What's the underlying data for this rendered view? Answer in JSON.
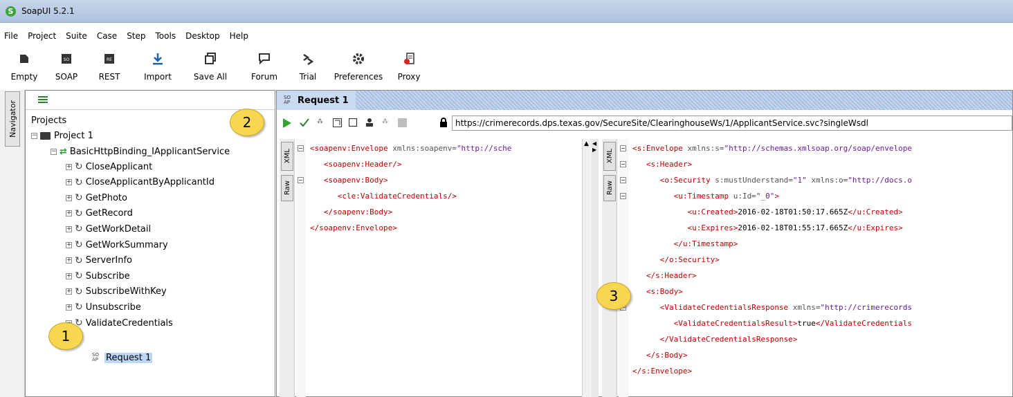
{
  "window": {
    "title": "SoapUI 5.2.1"
  },
  "menu": [
    "File",
    "Project",
    "Suite",
    "Case",
    "Step",
    "Tools",
    "Desktop",
    "Help"
  ],
  "toolbar": [
    {
      "label": "Empty",
      "icon": "empty-project-icon"
    },
    {
      "label": "SOAP",
      "icon": "soap-icon"
    },
    {
      "label": "REST",
      "icon": "rest-icon"
    },
    {
      "label": "Import",
      "icon": "import-icon"
    },
    {
      "label": "Save All",
      "icon": "save-all-icon"
    },
    {
      "label": "Forum",
      "icon": "forum-icon"
    },
    {
      "label": "Trial",
      "icon": "trial-icon"
    },
    {
      "label": "Preferences",
      "icon": "preferences-icon"
    },
    {
      "label": "Proxy",
      "icon": "proxy-icon"
    }
  ],
  "navigator": {
    "tab": "Navigator",
    "root": "Projects",
    "project": "Project 1",
    "binding": "BasicHttpBinding_IApplicantService",
    "operations": [
      "CloseApplicant",
      "CloseApplicantByApplicantId",
      "GetPhoto",
      "GetRecord",
      "GetWorkDetail",
      "GetWorkSummary",
      "ServerInfo",
      "Subscribe",
      "SubscribeWithKey",
      "Unsubscribe",
      "ValidateCredentials"
    ],
    "selected_request": "Request 1",
    "soap_badge": "SO AP"
  },
  "request": {
    "title": "Request 1",
    "url": "https://crimerecords.dps.texas.gov/SecureSite/ClearinghouseWs/1/ApplicantService.svc?singleWsdl",
    "tabs": [
      "XML",
      "Raw"
    ]
  },
  "request_xml": [
    "<soapenv:Envelope xmlns:soapenv=\"http://sche",
    "   <soapenv:Header/>",
    "   <soapenv:Body>",
    "      <cle:ValidateCredentials/>",
    "   </soapenv:Body>",
    "</soapenv:Envelope>"
  ],
  "response_xml": [
    "<s:Envelope xmlns:s=\"http://schemas.xmlsoap.org/soap/envelope",
    "   <s:Header>",
    "      <o:Security s:mustUnderstand=\"1\" xmlns:o=\"http://docs.o",
    "         <u:Timestamp u:Id=\"_0\">",
    "            <u:Created>2016-02-18T01:50:17.665Z</u:Created>",
    "            <u:Expires>2016-02-18T01:55:17.665Z</u:Expires>",
    "         </u:Timestamp>",
    "      </o:Security>",
    "   </s:Header>",
    "   <s:Body>",
    "      <ValidateCredentialsResponse xmlns=\"http://crimerecords",
    "         <ValidateCredentialsResult>true</ValidateCredentials",
    "      </ValidateCredentialsResponse>",
    "   </s:Body>",
    "</s:Envelope>"
  ],
  "callouts": [
    "1",
    "2",
    "3"
  ]
}
